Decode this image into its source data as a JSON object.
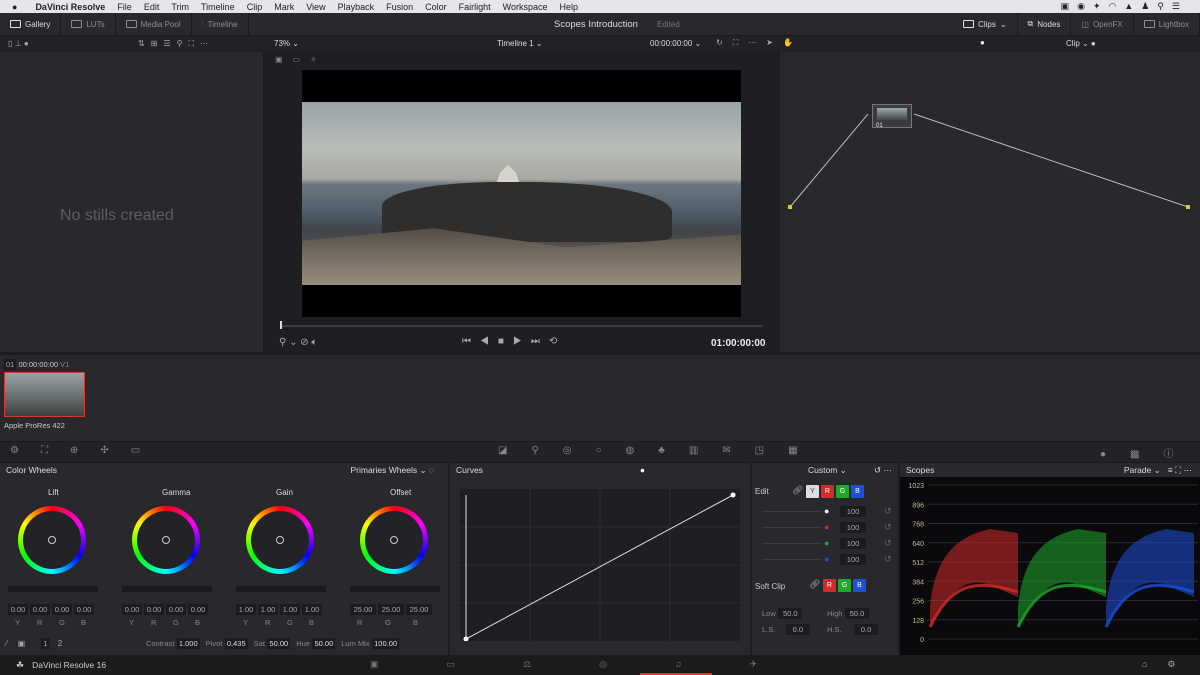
{
  "menubar": {
    "app": "DaVinci Resolve",
    "items": [
      "File",
      "Edit",
      "Trim",
      "Timeline",
      "Clip",
      "Mark",
      "View",
      "Playback",
      "Fusion",
      "Color",
      "Fairlight",
      "Workspace",
      "Help"
    ]
  },
  "topbar": {
    "left": [
      "Gallery",
      "LUTs",
      "Media Pool",
      "Timeline"
    ],
    "project": "Scopes Introduction",
    "status": "Edited",
    "right": [
      "Clips",
      "Nodes",
      "OpenFX",
      "Lightbox"
    ]
  },
  "subbar": {
    "zoom": "73%",
    "timeline": "Timeline 1",
    "timecode": "00:00:00:00",
    "mode": "Clip"
  },
  "gallery": {
    "empty": "No stills created"
  },
  "viewer": {
    "timecode": "01:00:00:00"
  },
  "nodes": {
    "node_label": "01"
  },
  "timeline": {
    "clip_num": "01",
    "clip_tc": "00:00:00:00",
    "track": "V1",
    "clip_codec": "Apple ProRes 422"
  },
  "color_wheels": {
    "title": "Color Wheels",
    "mode": "Primaries Wheels",
    "wheels": [
      {
        "name": "Lift",
        "values": [
          "0.00",
          "0.00",
          "0.00",
          "0.00"
        ],
        "labels": [
          "Y",
          "R",
          "G",
          "B"
        ]
      },
      {
        "name": "Gamma",
        "values": [
          "0.00",
          "0.00",
          "0.00",
          "0.00"
        ],
        "labels": [
          "Y",
          "R",
          "G",
          "B"
        ]
      },
      {
        "name": "Gain",
        "values": [
          "1.00",
          "1.00",
          "1.00",
          "1.00"
        ],
        "labels": [
          "Y",
          "R",
          "G",
          "B"
        ]
      },
      {
        "name": "Offset",
        "values": [
          "25.00",
          "25.00",
          "25.00"
        ],
        "labels": [
          "R",
          "G",
          "B"
        ]
      }
    ],
    "pages": [
      "1",
      "2"
    ],
    "params": [
      {
        "label": "Contrast",
        "value": "1.000"
      },
      {
        "label": "Pivot",
        "value": "0.435"
      },
      {
        "label": "Sat",
        "value": "50.00"
      },
      {
        "label": "Hue",
        "value": "50.00"
      },
      {
        "label": "Lum Mix",
        "value": "100.00"
      }
    ]
  },
  "curves": {
    "title": "Curves",
    "mode": "Custom",
    "edit_label": "Edit",
    "channels": [
      "Y",
      "R",
      "G",
      "B"
    ],
    "intensity": [
      "100",
      "100",
      "100",
      "100"
    ],
    "soft_clip": "Soft Clip",
    "low_label": "Low",
    "low": "50.0",
    "high_label": "High",
    "high": "50.0",
    "ls_label": "L.S.",
    "ls": "0.0",
    "hs_label": "H.S.",
    "hs": "0.0"
  },
  "scopes": {
    "title": "Scopes",
    "mode": "Parade",
    "ticks": [
      "1023",
      "896",
      "768",
      "640",
      "512",
      "384",
      "256",
      "128",
      "0"
    ]
  },
  "bottombar": {
    "app": "DaVinci Resolve 16"
  },
  "colors": {
    "red": "#d42a2a",
    "green": "#1fa82a",
    "blue": "#1d4fd9",
    "accent_clip": "#d33b2e"
  }
}
